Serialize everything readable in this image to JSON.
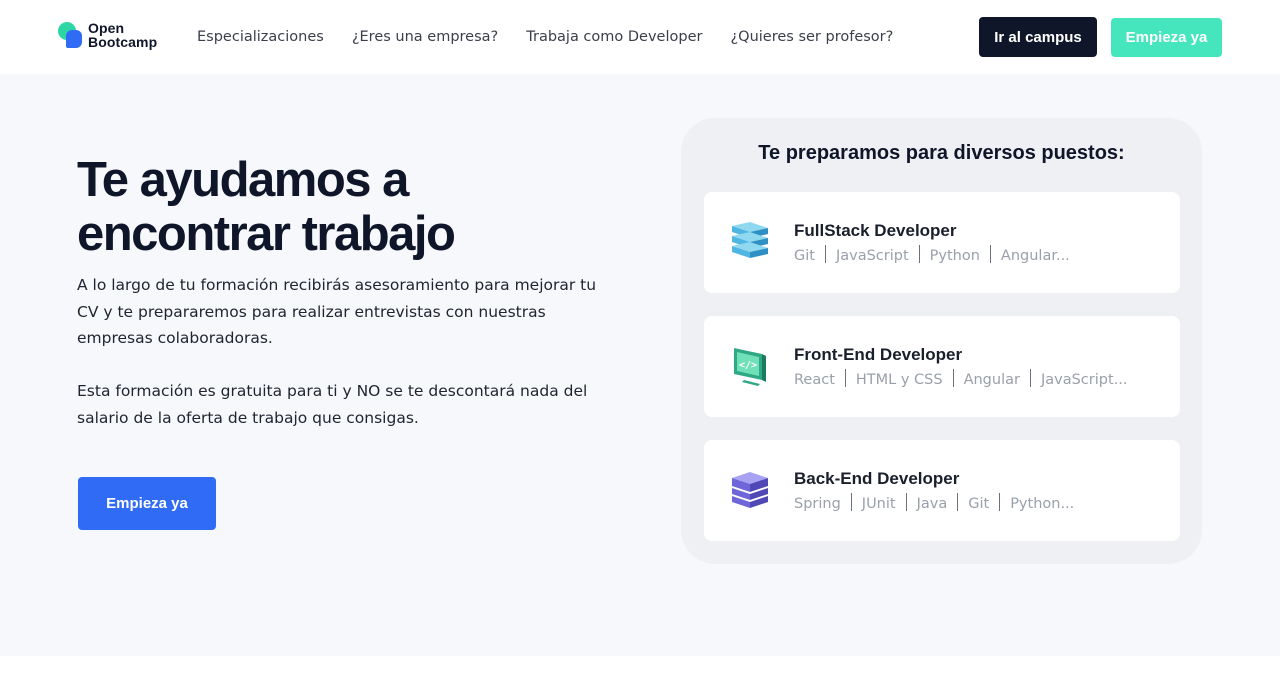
{
  "header": {
    "logo": {
      "line1": "Open",
      "line2": "Bootcamp"
    },
    "nav": [
      {
        "label": "Especializaciones"
      },
      {
        "label": "¿Eres una empresa?"
      },
      {
        "label": "Trabaja como Developer"
      },
      {
        "label": "¿Quieres ser profesor?"
      }
    ],
    "campus_button": "Ir al campus",
    "start_button": "Empieza ya"
  },
  "hero": {
    "title_line1": "Te ayudamos a",
    "title_line2": "encontrar trabajo",
    "paragraph1": "A lo largo de tu formación recibirás asesoramiento para mejorar tu CV y te prepararemos para realizar entrevistas con nuestras empresas colaboradoras.",
    "paragraph2": "Esta formación es gratuita para ti y NO se te descontará nada del salario de la oferta de trabajo que consigas.",
    "cta": "Empieza ya"
  },
  "panel": {
    "title": "Te preparamos para diversos puestos:",
    "cards": [
      {
        "icon": "layers-stack-icon",
        "title": "FullStack Developer",
        "tags": [
          "Git",
          "JavaScript",
          "Python",
          "Angular..."
        ]
      },
      {
        "icon": "code-monitor-icon",
        "title": "Front-End Developer",
        "tags": [
          "React",
          "HTML y CSS",
          "Angular",
          "JavaScript..."
        ]
      },
      {
        "icon": "server-stack-icon",
        "title": "Back-End Developer",
        "tags": [
          "Spring",
          "JUnit",
          "Java",
          "Git",
          "Python..."
        ]
      }
    ]
  },
  "colors": {
    "brand_dark": "#0f1629",
    "brand_blue": "#2f6bf5",
    "brand_mint": "#45e6bd",
    "page_bg": "#f7f8fc"
  }
}
